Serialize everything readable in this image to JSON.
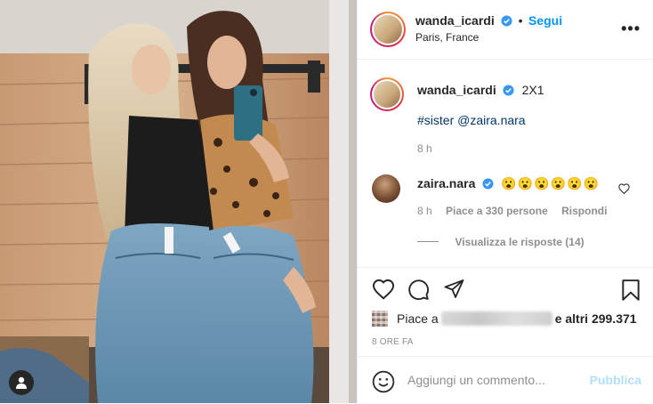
{
  "post": {
    "author": "wanda_icardi",
    "follow_label": "Segui",
    "location": "Paris, France",
    "more_label": "•••"
  },
  "caption": {
    "author": "wanda_icardi",
    "text": "2X1",
    "tags": "#sister @zaira.nara",
    "time": "8 h"
  },
  "comment": {
    "author": "zaira.nara",
    "text": "😮😮😮😮😮😮",
    "time": "8 h",
    "likes": "Piace a 330 persone",
    "reply_label": "Rispondi",
    "view_replies": "Visualizza le risposte (14)"
  },
  "likes": {
    "prefix": "Piace a",
    "suffix": "e altri 299.371"
  },
  "date": "8 ORE FA",
  "comment_box": {
    "placeholder": "Aggiungi un commento...",
    "publish_label": "Pubblica"
  },
  "colors": {
    "accent": "#0095f6",
    "publish_disabled": "#b2dffc",
    "muted": "#8e8e8e"
  }
}
